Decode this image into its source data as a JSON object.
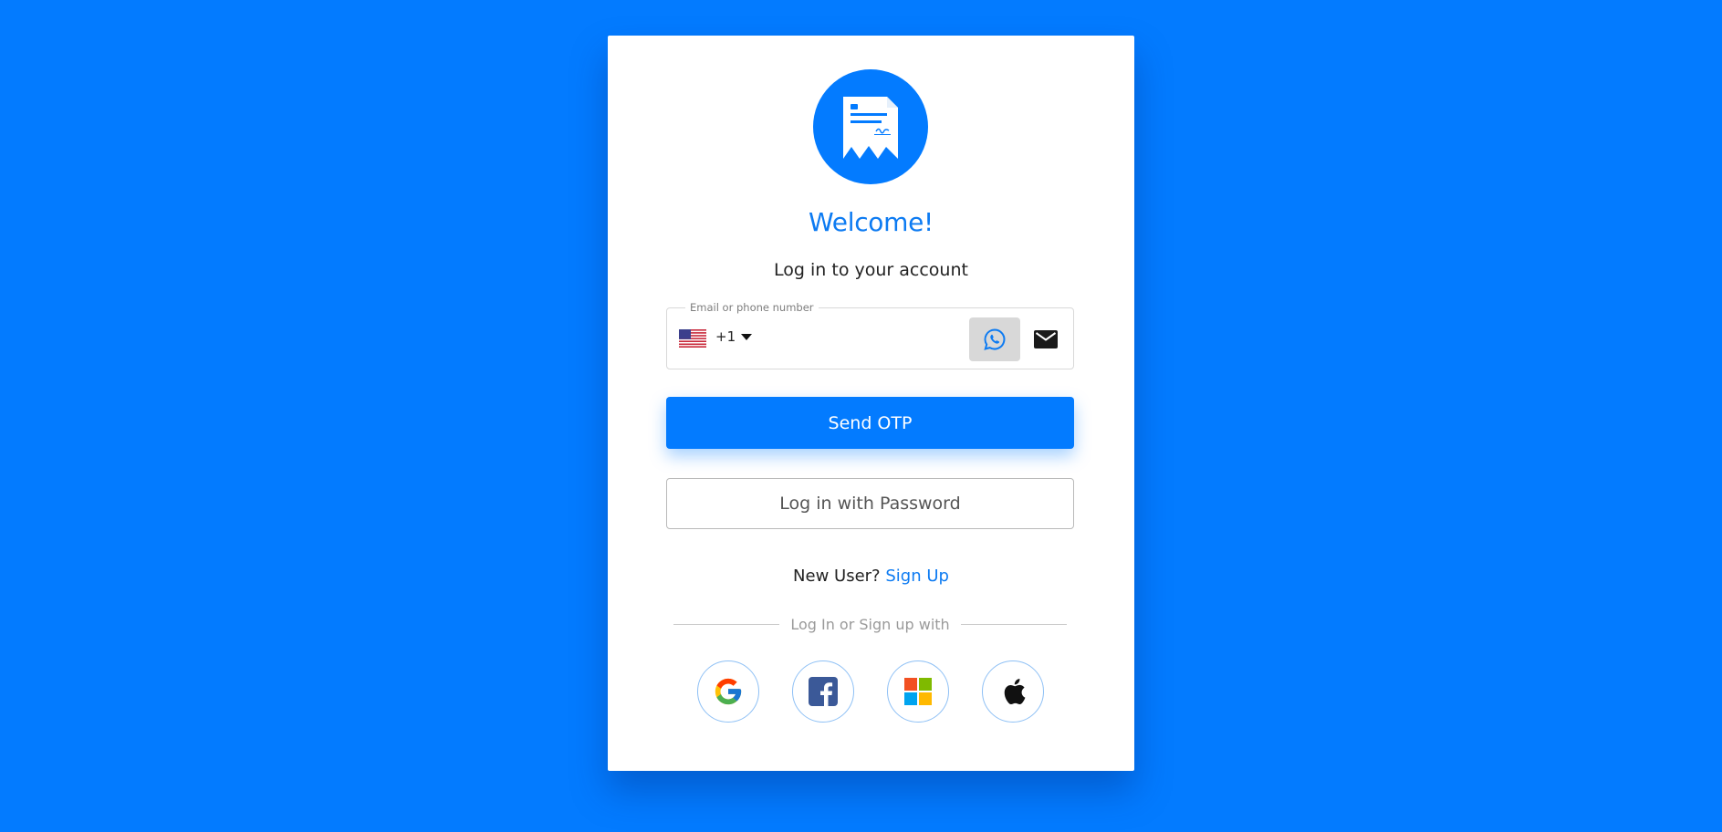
{
  "header": {
    "title": "Welcome!",
    "subtitle": "Log in to your account"
  },
  "login_field": {
    "label": "Email or phone number",
    "country_flag": "us-flag-icon",
    "dial_code": "+1",
    "value": "",
    "channel_options": [
      "whatsapp-icon",
      "mail-icon"
    ],
    "selected_channel": "whatsapp"
  },
  "actions": {
    "send_otp_label": "Send OTP",
    "password_login_label": "Log in with Password"
  },
  "signup": {
    "prompt": "New User?",
    "link_label": "Sign Up"
  },
  "social": {
    "divider_text": "Log In or Sign up with",
    "providers": [
      "google-icon",
      "facebook-icon",
      "microsoft-icon",
      "apple-icon"
    ]
  },
  "colors": {
    "background": "#037bff",
    "accent": "#0d7bf2",
    "card": "#ffffff"
  }
}
